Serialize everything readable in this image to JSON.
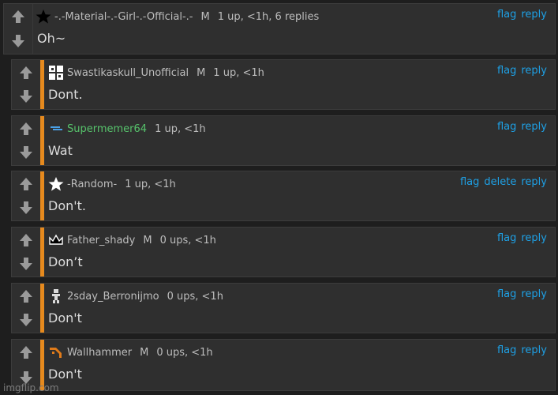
{
  "comments": [
    {
      "username": "-.-Material-.-Girl-.-Official-.-",
      "badge": "M",
      "meta": "1 up, <1h, 6 replies",
      "body": "Oh~",
      "flag": "flag",
      "delete": "",
      "reply": "reply",
      "avatar_icon": "black-star-icon"
    },
    {
      "username": "Swastikaskull_Unofficial",
      "badge": "M",
      "meta": "1 up, <1h",
      "body": "Dont.",
      "flag": "flag",
      "delete": "",
      "reply": "reply",
      "avatar_icon": "cross-grid-icon"
    },
    {
      "username": "Supermemer64",
      "badge": "",
      "meta": "1 up, <1h",
      "body": "Wat",
      "flag": "flag",
      "delete": "",
      "reply": "reply",
      "avatar_icon": "dash-icon",
      "name_color": "#56c26b"
    },
    {
      "username": "-Random-",
      "badge": "",
      "meta": "1 up, <1h",
      "body": "Don't.",
      "flag": "flag",
      "delete": "delete",
      "reply": "reply",
      "avatar_icon": "white-star-icon"
    },
    {
      "username": "Father_shady",
      "badge": "M",
      "meta": "0 ups, <1h",
      "body": "Don’t",
      "flag": "flag",
      "delete": "",
      "reply": "reply",
      "avatar_icon": "crown-icon"
    },
    {
      "username": "2sday_Berronijmo",
      "badge": "",
      "meta": "0 ups, <1h",
      "body": "Don't",
      "flag": "flag",
      "delete": "",
      "reply": "reply",
      "avatar_icon": "figure-icon"
    },
    {
      "username": "Wallhammer",
      "badge": "M",
      "meta": "0 ups, <1h",
      "body": "Don't",
      "flag": "flag",
      "delete": "",
      "reply": "reply",
      "avatar_icon": "pickaxe-icon"
    }
  ],
  "watermark": "imgflip.com",
  "colors": {
    "accent": "#e68a1e",
    "link": "#1ea1e6",
    "green_name": "#56c26b",
    "panel": "#2f2f2f"
  }
}
